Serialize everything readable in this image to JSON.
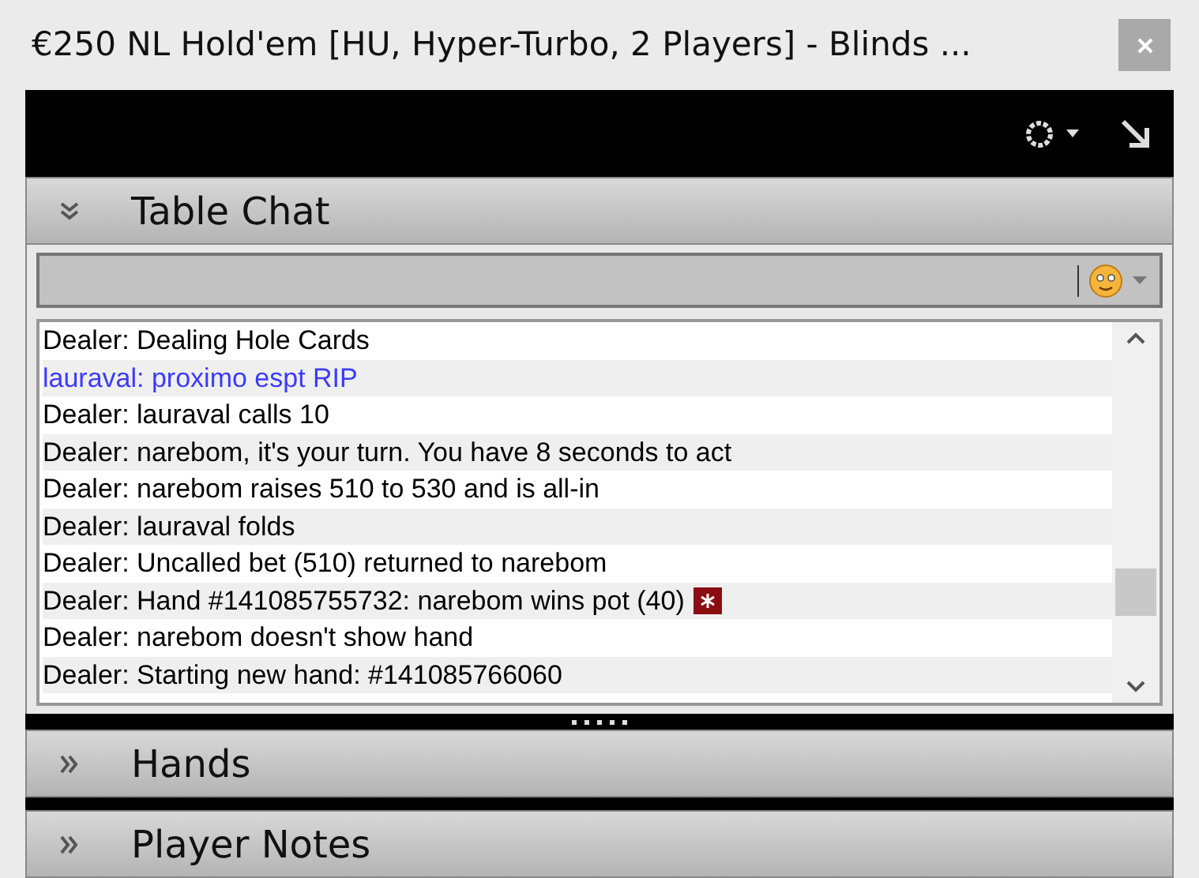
{
  "window": {
    "title": "€250 NL Hold'em [HU, Hyper-Turbo, 2 Players] - Blinds ..."
  },
  "sections": [
    {
      "title": "Table Chat",
      "expanded": true
    },
    {
      "title": "Hands",
      "expanded": false
    },
    {
      "title": "Player Notes",
      "expanded": false
    }
  ],
  "chat": {
    "messages": [
      {
        "kind": "dealer",
        "text": "Dealer: Dealing Hole Cards"
      },
      {
        "kind": "player",
        "text": "lauraval: proximo espt RIP"
      },
      {
        "kind": "dealer",
        "text": "Dealer: lauraval calls 10"
      },
      {
        "kind": "dealer",
        "text": "Dealer: narebom, it's your turn. You have 8 seconds to act"
      },
      {
        "kind": "dealer",
        "text": "Dealer: narebom raises 510 to 530 and is all-in"
      },
      {
        "kind": "dealer",
        "text": "Dealer: lauraval folds"
      },
      {
        "kind": "dealer",
        "text": "Dealer: Uncalled bet (510) returned to narebom"
      },
      {
        "kind": "dealer",
        "text": "Dealer: Hand #141085755732: narebom wins pot (40)",
        "hand_icon": true
      },
      {
        "kind": "dealer",
        "text": "Dealer: narebom doesn't show hand"
      },
      {
        "kind": "dealer",
        "text": "Dealer: Starting new hand: #141085766060"
      }
    ]
  }
}
